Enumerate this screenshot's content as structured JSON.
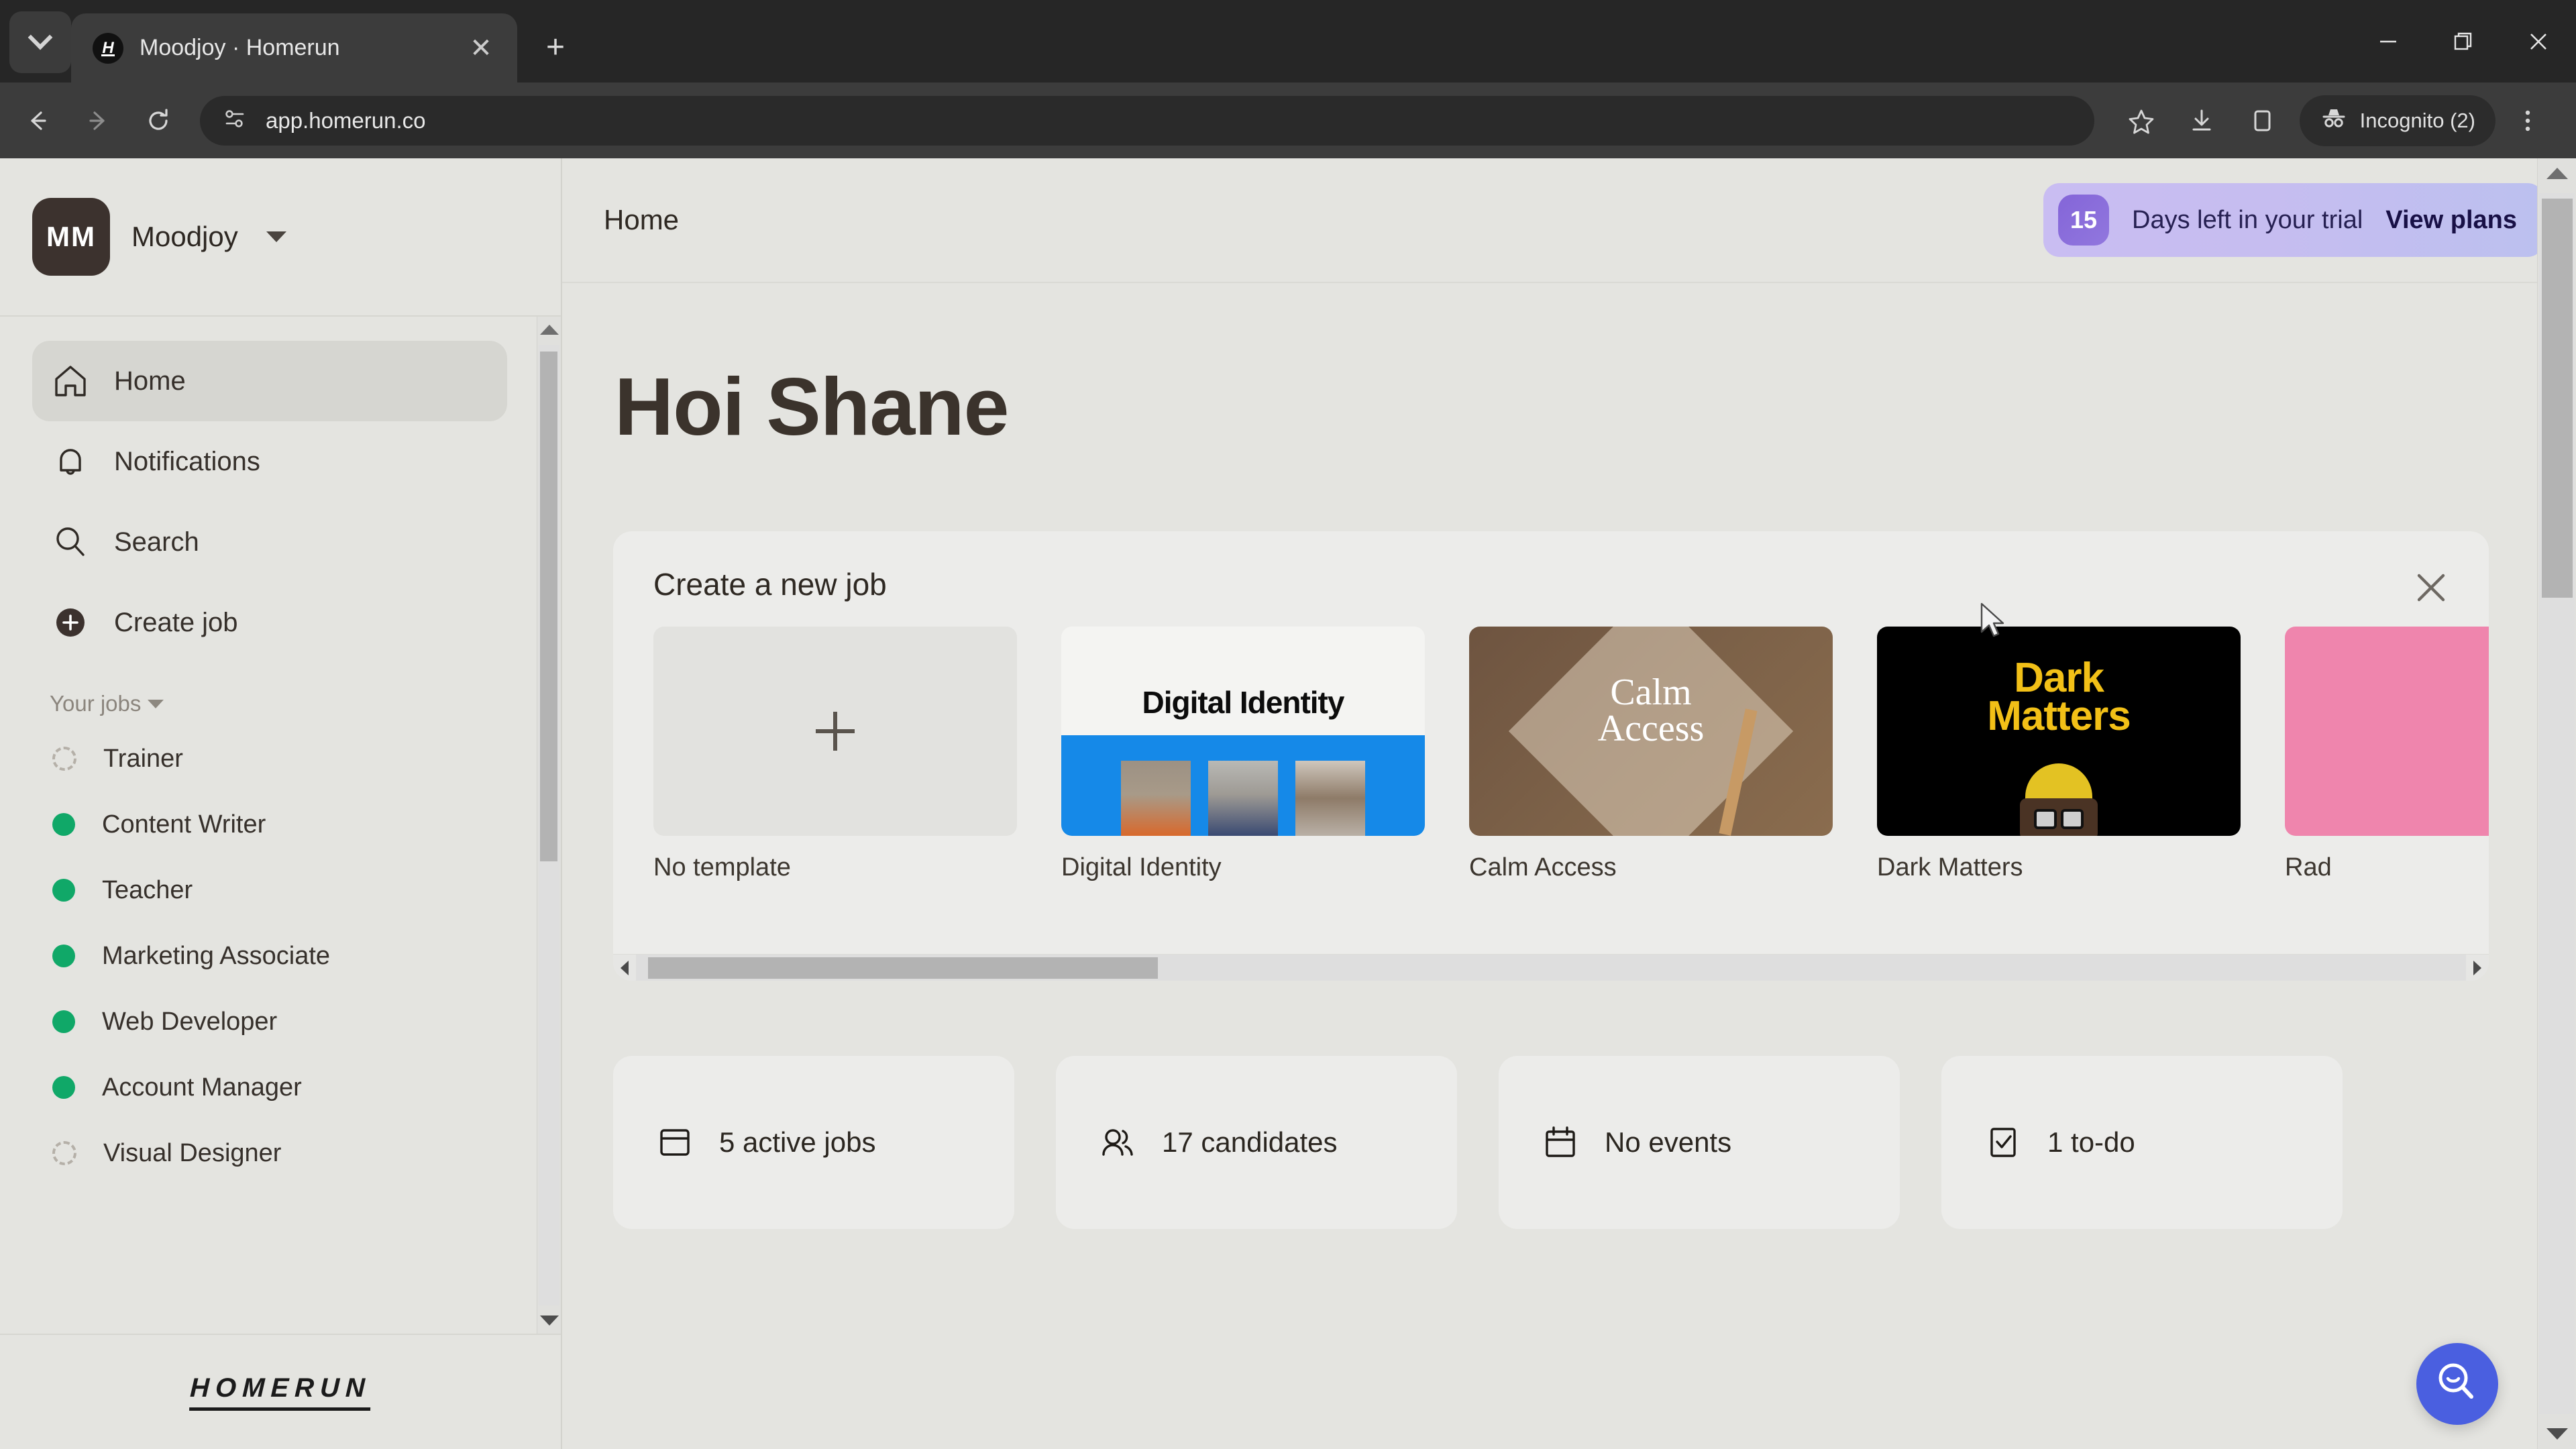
{
  "browser": {
    "tab": {
      "title": "Moodjoy · Homerun",
      "favicon_letter": "H",
      "close_icon": "close-icon"
    },
    "new_tab_label": "+",
    "tab_search_icon": "chevron-down-icon",
    "url": "app.homerun.co",
    "site_info_icon": "page-settings-icon",
    "bookmark_icon": "star-icon",
    "download_icon": "download-icon",
    "sidepanel_icon": "side-panel-icon",
    "profile_label": "Incognito (2)",
    "profile_icon": "incognito-icon",
    "menu_icon": "three-dots-icon",
    "window": {
      "minimize": "minimize-icon",
      "maximize": "restore-icon",
      "close": "close-icon"
    }
  },
  "sidebar": {
    "org": {
      "initials": "MM",
      "name": "Moodjoy",
      "caret_icon": "chevron-down-icon"
    },
    "nav": [
      {
        "label": "Home",
        "icon": "home-icon",
        "active": true
      },
      {
        "label": "Notifications",
        "icon": "bell-icon",
        "active": false
      },
      {
        "label": "Search",
        "icon": "search-icon",
        "active": false
      },
      {
        "label": "Create job",
        "icon": "plus-circle-icon",
        "active": false
      }
    ],
    "jobs_section_label": "Your jobs",
    "jobs_section_caret": "chevron-down-icon",
    "jobs": [
      {
        "label": "Trainer",
        "status": "draft"
      },
      {
        "label": "Content Writer",
        "status": "live"
      },
      {
        "label": "Teacher",
        "status": "live"
      },
      {
        "label": "Marketing Associate",
        "status": "live"
      },
      {
        "label": "Web Developer",
        "status": "live"
      },
      {
        "label": "Account Manager",
        "status": "live"
      },
      {
        "label": "Visual Designer",
        "status": "draft"
      }
    ],
    "footer_logo": "HOMERUN",
    "status_colors": {
      "live": "#10a868",
      "draft": "#b5b0a8"
    }
  },
  "topbar": {
    "page_title": "Home",
    "trial": {
      "days": "15",
      "text": "Days left in your trial",
      "link": "View plans",
      "gradient_from": "#c9bdf2",
      "gradient_to": "#bcc0ef",
      "badge_color": "#8465d8"
    }
  },
  "main": {
    "greeting": "Hoi Shane",
    "new_job_card": {
      "title": "Create a new job",
      "close_icon": "close-icon",
      "templates": [
        {
          "label": "No template",
          "kind": "empty",
          "icon": "plus-icon"
        },
        {
          "label": "Digital Identity",
          "kind": "digital-identity",
          "headline": "Digital Identity",
          "accent": "#1589e8"
        },
        {
          "label": "Calm Access",
          "kind": "calm-access",
          "headline": "Calm Access",
          "accent": "#7c6148"
        },
        {
          "label": "Dark Matters",
          "kind": "dark-matters",
          "headline": "Dark Matters",
          "accent": "#f2c017"
        },
        {
          "label": "Rad",
          "kind": "radical",
          "headline": "",
          "accent": "#ef85ad"
        }
      ],
      "scroll_left_icon": "triangle-left-icon",
      "scroll_right_icon": "triangle-right-icon"
    },
    "stats": [
      {
        "label": "5 active jobs",
        "icon": "jobs-board-icon"
      },
      {
        "label": "17 candidates",
        "icon": "people-icon"
      },
      {
        "label": "No events",
        "icon": "calendar-icon"
      },
      {
        "label": "1 to-do",
        "icon": "checkbox-icon"
      }
    ],
    "fab": {
      "icon": "search-smile-icon",
      "color": "#4a5fe0"
    }
  }
}
